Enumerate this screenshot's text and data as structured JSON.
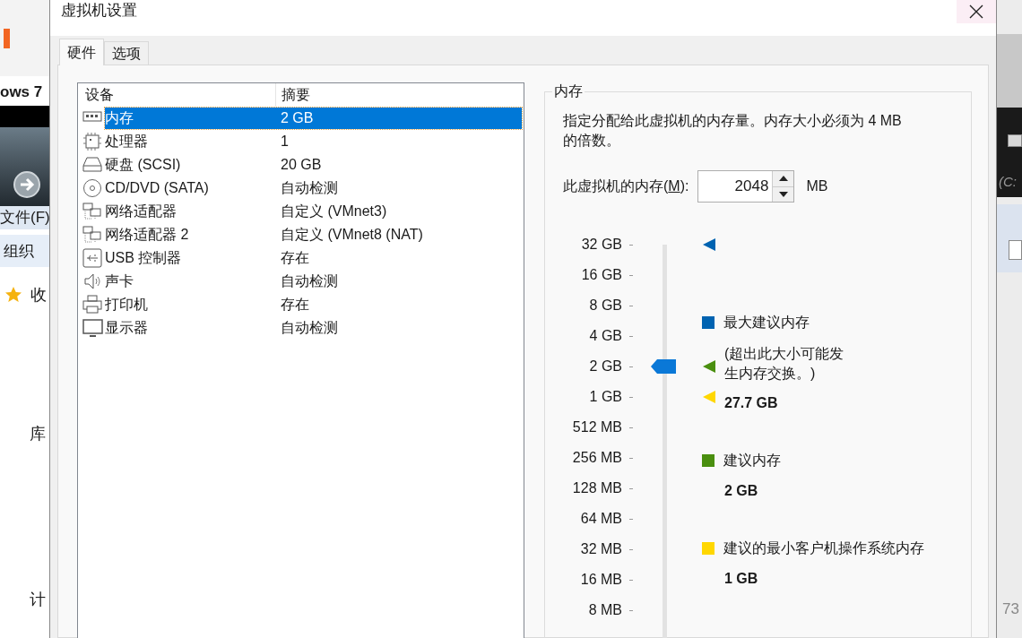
{
  "background": {
    "left_texts": [
      "ows 7",
      "文件(F)",
      "组织",
      "收",
      "库",
      "计"
    ],
    "right_texts": [
      "(C:",
      "73"
    ]
  },
  "window": {
    "title": "虚拟机设置"
  },
  "tabs": [
    {
      "label": "硬件",
      "selected": true
    },
    {
      "label": "选项",
      "selected": false
    }
  ],
  "device_list": {
    "columns": [
      "设备",
      "摘要"
    ],
    "rows": [
      {
        "kind": "memory",
        "device": "内存",
        "summary": "2 GB",
        "selected": true
      },
      {
        "kind": "processor",
        "device": "处理器",
        "summary": "1",
        "selected": false
      },
      {
        "kind": "disk",
        "device": "硬盘 (SCSI)",
        "summary": "20 GB",
        "selected": false
      },
      {
        "kind": "cdrom",
        "device": "CD/DVD (SATA)",
        "summary": "自动检测",
        "selected": false
      },
      {
        "kind": "network",
        "device": "网络适配器",
        "summary": "自定义 (VMnet3)",
        "selected": false
      },
      {
        "kind": "network",
        "device": "网络适配器 2",
        "summary": "自定义 (VMnet8 (NAT)",
        "selected": false
      },
      {
        "kind": "usb",
        "device": "USB 控制器",
        "summary": "存在",
        "selected": false
      },
      {
        "kind": "sound",
        "device": "声卡",
        "summary": "自动检测",
        "selected": false
      },
      {
        "kind": "printer",
        "device": "打印机",
        "summary": "存在",
        "selected": false
      },
      {
        "kind": "display",
        "device": "显示器",
        "summary": "自动检测",
        "selected": false
      }
    ]
  },
  "memory_panel": {
    "title": "内存",
    "description": "指定分配给此虚拟机的内存量。内存大小必须为 4 MB 的倍数。",
    "field_label_before": "此虚拟机的内存(",
    "field_label_key": "M",
    "field_label_after": "):",
    "value": "2048",
    "unit": "MB",
    "slider": {
      "level": 0.692,
      "ticks": [
        "32 GB",
        "16 GB",
        "8 GB",
        "4 GB",
        "2 GB",
        "1 GB",
        "512 MB",
        "256 MB",
        "128 MB",
        "64 MB",
        "32 MB",
        "16 MB",
        "8 MB"
      ],
      "markers": [
        {
          "color": "#0063b1",
          "level": 1
        },
        {
          "color": "#4a8f0f",
          "level": 0.692
        },
        {
          "color": "#ffd700",
          "level": 0.615
        }
      ]
    },
    "legend": [
      {
        "color": "#0063b1",
        "title": "最大建议内存",
        "note": "(超出此大小可能发生内存交换。)",
        "value": "27.7 GB"
      },
      {
        "color": "#4a8f0f",
        "title": "建议内存",
        "value": "2 GB"
      },
      {
        "color": "#ffd700",
        "title": "建议的最小客户机操作系统内存",
        "value": "1 GB"
      }
    ]
  }
}
